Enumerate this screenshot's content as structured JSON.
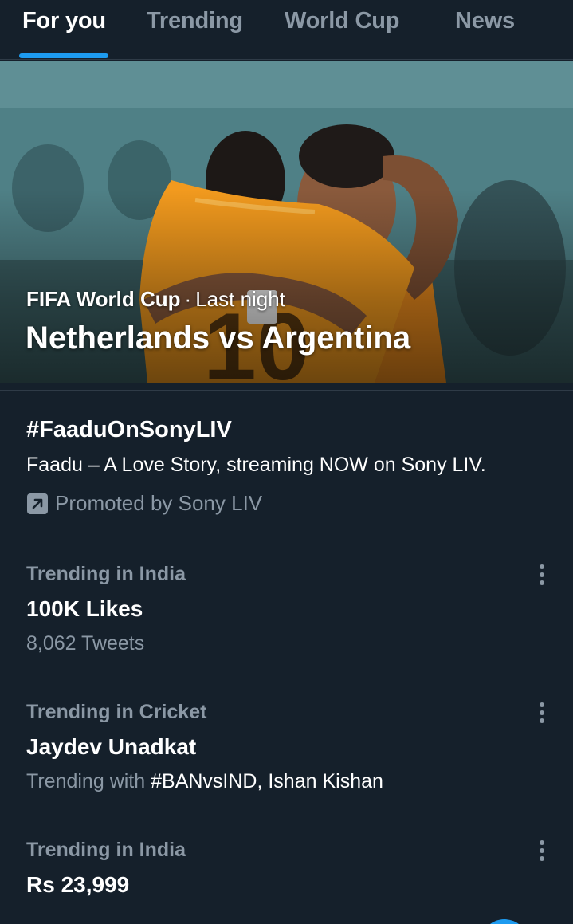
{
  "tabs": [
    {
      "label": "For you"
    },
    {
      "label": "Trending"
    },
    {
      "label": "World Cup"
    },
    {
      "label": "News"
    }
  ],
  "hero": {
    "category": "FIFA World Cup",
    "separator": "·",
    "time": "Last night",
    "title": "Netherlands vs Argentina"
  },
  "promoted": {
    "hashtag": "#FaaduOnSonyLIV",
    "description": "Faadu – A Love Story, streaming NOW on Sony LIV.",
    "promoted_by": "Promoted by Sony LIV",
    "icon": "promoted-arrow-icon"
  },
  "trends": [
    {
      "context": "Trending in India",
      "title": "100K Likes",
      "sub": "8,062 Tweets"
    },
    {
      "context": "Trending in Cricket",
      "title": "Jaydev Unadkat",
      "sub_prefix": "Trending with",
      "sub_highlight": "#BANvsIND, Ishan Kishan"
    },
    {
      "context": "Trending in India",
      "title": "Rs 23,999"
    }
  ],
  "icons": {
    "more": "more-vertical-icon"
  },
  "colors": {
    "background": "#15202b",
    "accent": "#1d9bf0",
    "secondary_text": "#8b98a5",
    "divider": "#2f3b47"
  }
}
